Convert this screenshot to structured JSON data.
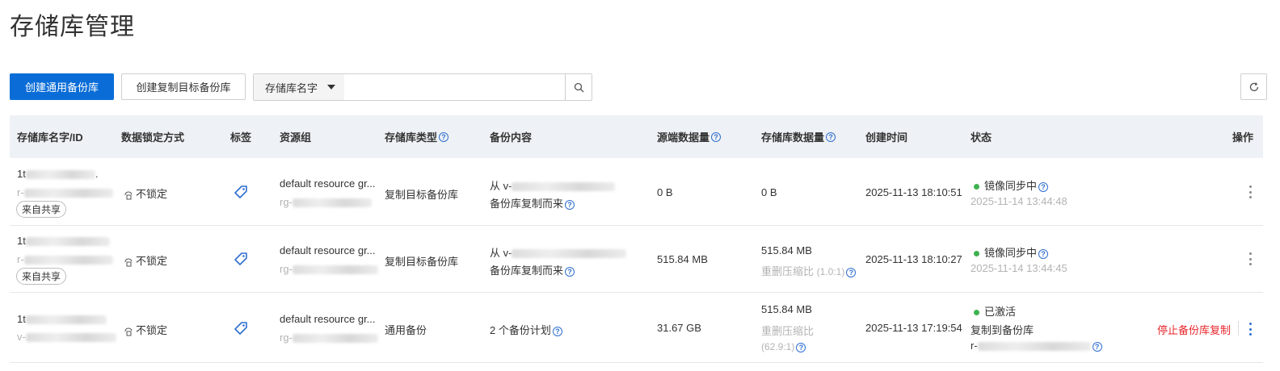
{
  "page": {
    "title": "存储库管理"
  },
  "toolbar": {
    "create_general": "创建通用备份库",
    "create_replica": "创建复制目标备份库",
    "search_field": "存储库名字",
    "search_placeholder": ""
  },
  "table": {
    "headers": {
      "name": "存储库名字/ID",
      "lock": "数据锁定方式",
      "tag": "标签",
      "resource_group": "资源组",
      "vault_type": "存储库类型",
      "content": "备份内容",
      "source_size": "源端数据量",
      "vault_size": "存储库数据量",
      "created": "创建时间",
      "status": "状态",
      "actions": "操作"
    },
    "rows": [
      {
        "name_prefix": "1t",
        "name_suffix": ".",
        "id_prefix": "r-",
        "shared_badge": "来自共享",
        "lock": "不锁定",
        "rg_name": "default resource gr...",
        "rg_id_prefix": "rg-",
        "vault_type": "复制目标备份库",
        "content_line1": "从 v-",
        "content_line2": "备份库复制而来",
        "source_size": "0 B",
        "vault_size": "0 B",
        "created": "2025-11-13 18:10:51",
        "status": "镜像同步中",
        "status_time": "2025-11-14 13:44:48"
      },
      {
        "name_prefix": "1t",
        "id_prefix": "r-",
        "shared_badge": "来自共享",
        "lock": "不锁定",
        "rg_name": "default resource gr...",
        "rg_id_prefix": "rg-",
        "vault_type": "复制目标备份库",
        "content_line1": "从 v-",
        "content_line2": "备份库复制而来",
        "source_size": "515.84 MB",
        "vault_size": "515.84 MB",
        "dedup_label": "重删压缩比",
        "dedup_ratio": "(1.0:1)",
        "created": "2025-11-13 18:10:27",
        "status": "镜像同步中",
        "status_time": "2025-11-14 13:44:45"
      },
      {
        "name_prefix": "1t",
        "id_prefix": "v-",
        "lock": "不锁定",
        "rg_name": "default resource gr...",
        "rg_id_prefix": "rg-",
        "vault_type": "通用备份",
        "content_line1": "2 个备份计划",
        "source_size": "31.67 GB",
        "vault_size": "515.84 MB",
        "dedup_label": "重删压缩比",
        "dedup_ratio": "(62.9:1)",
        "created": "2025-11-13 17:19:54",
        "status": "已激活",
        "status_line2": "复制到备份库",
        "status_line3_prefix": "r-",
        "action_stop": "停止备份库复制"
      }
    ]
  },
  "colors": {
    "primary": "#0a6dd7",
    "danger": "#e8262b",
    "success": "#3fb24f",
    "link": "#2f6fd0"
  },
  "icons": [
    "search-icon",
    "refresh-icon",
    "caret-down-icon",
    "help-icon",
    "lock-open-icon",
    "tag-icon",
    "more-vertical-icon"
  ]
}
